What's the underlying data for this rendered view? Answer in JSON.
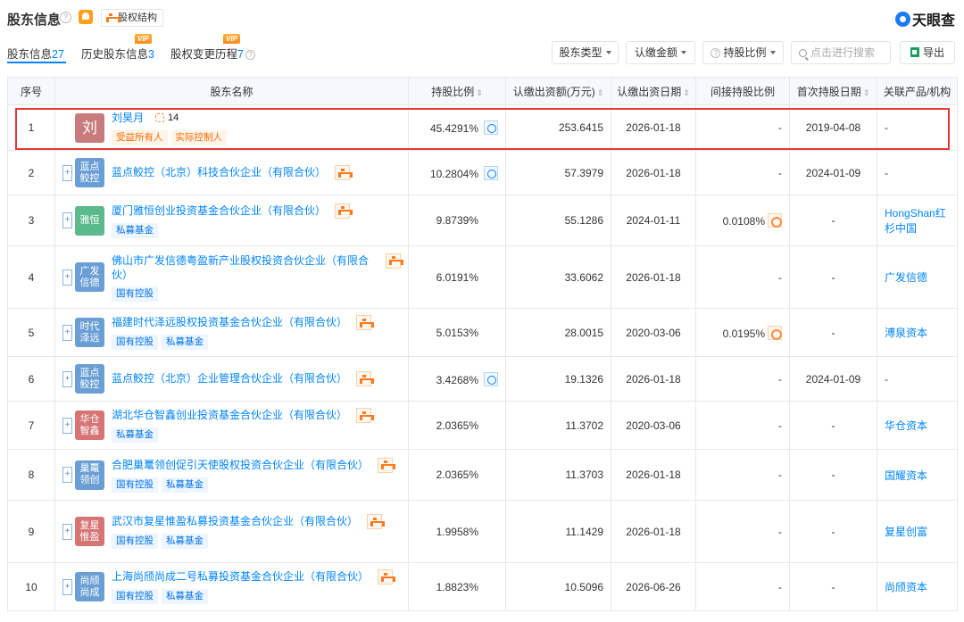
{
  "header": {
    "title": "股东信息",
    "equity_structure_btn": "股权结构",
    "logo_text": "天眼查"
  },
  "tabs": [
    {
      "label": "股东信息",
      "count": "27",
      "vip": ""
    },
    {
      "label": "历史股东信息",
      "count": "3",
      "vip": "VIP"
    },
    {
      "label": "股权变更历程",
      "count": "7",
      "vip": "VIP"
    }
  ],
  "filters": {
    "type": "股东类型",
    "amount": "认缴金额",
    "ratio": "持股比例",
    "search_placeholder": "点击进行搜索",
    "export": "导出"
  },
  "columns": [
    "序号",
    "股东名称",
    "持股比例",
    "认缴出资额(万元)",
    "认缴出资日期",
    "间接持股比例",
    "首次持股日期",
    "关联产品/机构"
  ],
  "colors": {
    "accent": "#0084ff",
    "highlight": "#e53935",
    "tag_orange": "#ff6a00"
  },
  "rows": [
    {
      "idx": "1",
      "avatar": "刘",
      "avatar_color": "#c97b7b",
      "name": "刘昊月",
      "rel_count": "14",
      "tags": [
        "受益所有人",
        "实际控制人"
      ],
      "tag_style": "orange",
      "ratio": "45.4291%",
      "pie": true,
      "amount": "253.6415",
      "date": "2026-01-18",
      "indirect": "-",
      "indirect_icon": false,
      "first": "2019-04-08",
      "product": "-"
    },
    {
      "idx": "2",
      "avatar": "蓝点鲛控",
      "avatar_color": "#6a9fd6",
      "name": "蓝点鲛控（北京）科技合伙企业（有限合伙）",
      "rel_count": "",
      "tags": [],
      "ratio": "10.2804%",
      "pie": true,
      "amount": "57.3979",
      "date": "2026-01-18",
      "indirect": "-",
      "indirect_icon": false,
      "first": "2024-01-09",
      "product": "-"
    },
    {
      "idx": "3",
      "avatar": "雅恒",
      "avatar_color": "#5bb98c",
      "name": "厦门雅恒创业投资基金合伙企业（有限合伙）",
      "rel_count": "",
      "tags": [
        "私募基金"
      ],
      "ratio": "9.8739%",
      "pie": false,
      "amount": "55.1286",
      "date": "2024-01-11",
      "indirect": "0.0108%",
      "indirect_icon": true,
      "first": "-",
      "product": "HongShan红杉中国"
    },
    {
      "idx": "4",
      "avatar": "广发信德",
      "avatar_color": "#6a9fd6",
      "name": "佛山市广发信德粤盈新产业股权投资合伙企业（有限合伙）",
      "rel_count": "",
      "tags": [
        "国有控股"
      ],
      "ratio": "6.0191%",
      "pie": false,
      "amount": "33.6062",
      "date": "2026-01-18",
      "indirect": "-",
      "indirect_icon": false,
      "first": "-",
      "product": "广发信德"
    },
    {
      "idx": "5",
      "avatar": "时代泽远",
      "avatar_color": "#6a9fd6",
      "name": "福建时代泽远股权投资基金合伙企业（有限合伙）",
      "rel_count": "",
      "tags": [
        "国有控股",
        "私募基金"
      ],
      "ratio": "5.0153%",
      "pie": false,
      "amount": "28.0015",
      "date": "2020-03-06",
      "indirect": "0.0195%",
      "indirect_icon": true,
      "first": "-",
      "product": "溥泉资本"
    },
    {
      "idx": "6",
      "avatar": "蓝点鲛控",
      "avatar_color": "#6a9fd6",
      "name": "蓝点鲛控（北京）企业管理合伙企业（有限合伙）",
      "rel_count": "",
      "tags": [],
      "ratio": "3.4268%",
      "pie": true,
      "amount": "19.1326",
      "date": "2026-01-18",
      "indirect": "-",
      "indirect_icon": false,
      "first": "2024-01-09",
      "product": "-"
    },
    {
      "idx": "7",
      "avatar": "华仓智鑫",
      "avatar_color": "#d77474",
      "name": "湖北华仓智鑫创业投资基金合伙企业（有限合伙）",
      "rel_count": "",
      "tags": [
        "私募基金"
      ],
      "ratio": "2.0365%",
      "pie": false,
      "amount": "11.3702",
      "date": "2020-03-06",
      "indirect": "-",
      "indirect_icon": false,
      "first": "-",
      "product": "华仓资本"
    },
    {
      "idx": "8",
      "avatar": "巢鼍领创",
      "avatar_color": "#6a9fd6",
      "name": "合肥巢鼍领创促引天使股权投资合伙企业（有限合伙）",
      "rel_count": "",
      "tags": [
        "国有控股",
        "私募基金"
      ],
      "ratio": "2.0365%",
      "pie": false,
      "amount": "11.3703",
      "date": "2026-01-18",
      "indirect": "-",
      "indirect_icon": false,
      "first": "-",
      "product": "国耀资本"
    },
    {
      "idx": "9",
      "avatar": "复星惟盈",
      "avatar_color": "#d77474",
      "name": "武汉市复星惟盈私募投资基金合伙企业（有限合伙）",
      "rel_count": "",
      "tags": [
        "国有控股",
        "私募基金"
      ],
      "ratio": "1.9958%",
      "pie": false,
      "amount": "11.1429",
      "date": "2026-01-18",
      "indirect": "-",
      "indirect_icon": false,
      "first": "-",
      "product": "复星创富"
    },
    {
      "idx": "10",
      "avatar": "尚颀尚成",
      "avatar_color": "#6a9fd6",
      "name": "上海尚颀尚成二号私募投资基金合伙企业（有限合伙）",
      "rel_count": "",
      "tags": [
        "国有控股",
        "私募基金"
      ],
      "ratio": "1.8823%",
      "pie": false,
      "amount": "10.5096",
      "date": "2026-06-26",
      "indirect": "-",
      "indirect_icon": false,
      "first": "-",
      "product": "尚颀资本"
    }
  ]
}
